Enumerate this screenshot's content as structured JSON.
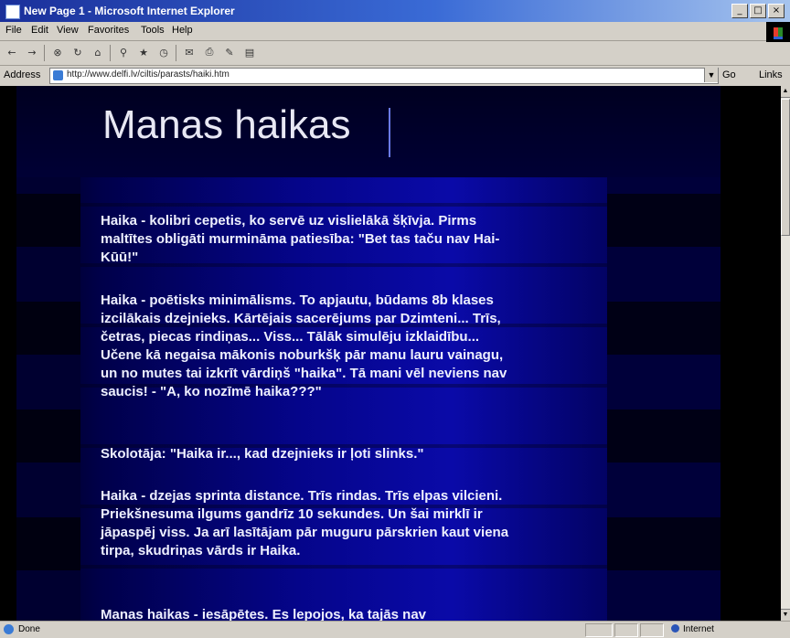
{
  "window": {
    "title": "New Page 1 - Microsoft Internet Explorer",
    "buttons": [
      "_",
      "□",
      "×"
    ]
  },
  "menu": [
    "File",
    "Edit",
    "View",
    "Favorites",
    "Tools",
    "Help"
  ],
  "toolbar": {
    "icons": [
      "back-icon",
      "forward-icon",
      "stop-icon",
      "refresh-icon",
      "home-icon",
      "search-icon",
      "favorites-icon",
      "history-icon",
      "mail-icon",
      "print-icon",
      "edit-icon",
      "discuss-icon"
    ]
  },
  "address": {
    "label": "Address",
    "url": "http://www.delfi.lv/ciltis/parasts/haiki.htm",
    "go": "Go",
    "links": "Links"
  },
  "page": {
    "title": "Manas haikas",
    "paragraphs": [
      "Haika - kolibri cepetis, ko servē uz vislielākā šķīvja. Pirms maltītes obligāti murmināma patiesība: \"Bet tas taču nav Hai-Kūū!\"",
      "Haika - poētisks minimālisms. To apjautu, būdams 8b klases izcilākais dzejnieks. Kārtējais sacerējums par Dzimteni... Trīs, četras, piecas rindiņas... Viss... Tālāk simulēju izklaidību... Učene kā negaisa mākonis noburkšķ pār manu lauru vainagu, un no mutes tai izkrīt vārdiņš \"haika\". Tā mani vēl neviens nav saucis! - \"A, ko nozīmē haika???\"",
      "Skolotāja: \"Haika ir..., kad dzejnieks ir ļoti slinks.\"",
      "Haika - dzejas sprinta distance. Trīs rindas. Trīs elpas vilcieni. Priekšnesuma ilgums gandrīz 10 sekundes. Un šai mirklī ir jāpaspēj viss. Ja arī lasītājam pār muguru pārskrien kaut viena tirpa, skudriņas vārds ir Haika.",
      "Manas haikas - iesāpētes. Es lepojos, ka tajās nav"
    ]
  },
  "status": {
    "text": "Done",
    "zone": "Internet"
  }
}
